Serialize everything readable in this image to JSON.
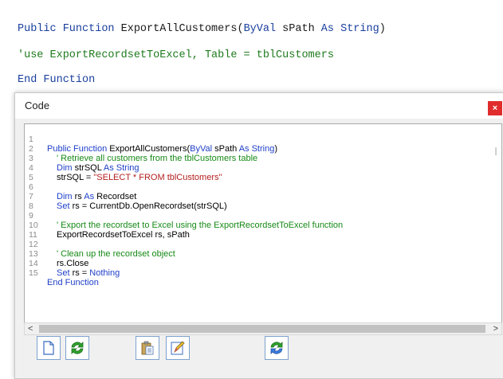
{
  "background_code": {
    "line1": {
      "kw1": "Public Function",
      "name": " ExportAllCustomers(",
      "kw2": "ByVal",
      "mid": " sPath ",
      "kw3": "As String",
      "end": ")"
    },
    "line2": "'use ExportRecordsetToExcel, Table = tblCustomers",
    "line3": "End Function"
  },
  "dialog": {
    "title": "Code",
    "close_label": "×"
  },
  "editor": {
    "line_numbers": [
      "1",
      "2",
      "3",
      "4",
      "5",
      "6",
      "7",
      "8",
      "9",
      "10",
      "11",
      "12",
      "13",
      "14",
      "15"
    ],
    "lines": {
      "l1": {
        "a": "Public Function",
        "b": " ExportAllCustomers(",
        "c": "ByVal",
        "d": " sPath ",
        "e": "As String",
        "f": ")"
      },
      "l2": "' Retrieve all customers from the tblCustomers table",
      "l3": {
        "a": "Dim",
        "b": " strSQL ",
        "c": "As String"
      },
      "l4": {
        "a": "strSQL = ",
        "b": "\"SELECT * FROM tblCustomers\""
      },
      "l6": {
        "a": "Dim",
        "b": " rs ",
        "c": "As",
        "d": " Recordset"
      },
      "l7": {
        "a": "Set",
        "b": " rs = CurrentDb.OpenRecordset(strSQL)"
      },
      "l9": "' Export the recordset to Excel using the ExportRecordsetToExcel function",
      "l10": "ExportRecordsetToExcel rs, sPath",
      "l12": "' Clean up the recordset object",
      "l13": "rs.Close",
      "l14": {
        "a": "Set",
        "b": " rs = ",
        "c": "Nothing"
      },
      "l15": "End Function"
    }
  },
  "scrollbar": {
    "left_arrow": "<",
    "right_arrow": ">"
  },
  "colors": {
    "keyword": "#1e3fc8",
    "comment": "#178a17",
    "string": "#b41e1e",
    "close_button": "#e02c2c"
  },
  "toolbar": {
    "buttons": [
      "new-document-icon",
      "refresh-icon",
      "paste-icon",
      "edit-icon",
      "refresh-icon"
    ]
  }
}
